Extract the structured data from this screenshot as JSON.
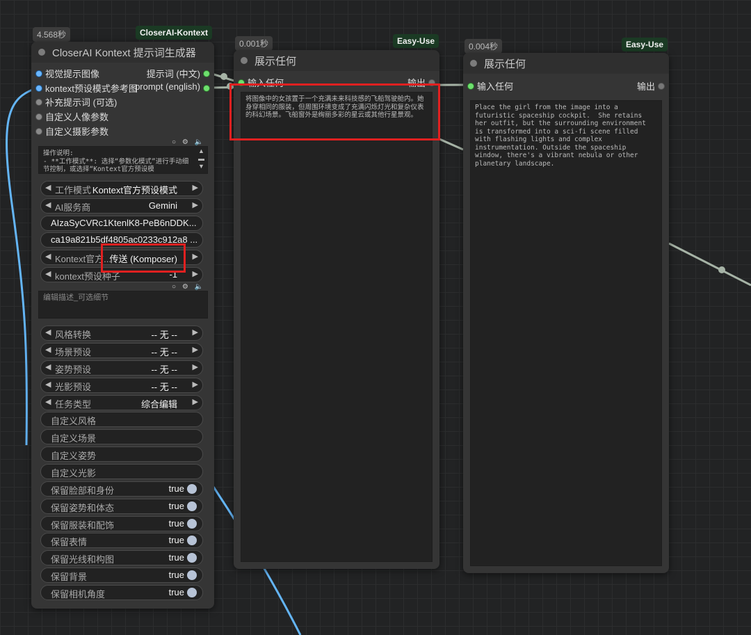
{
  "colors": {
    "canvas_bg": "#222324",
    "node_bg": "#353535",
    "wire_blue": "#64b5f6",
    "wire_gray": "#a6b3a6",
    "highlight": "#e02020",
    "tag_bg": "#1b3a24"
  },
  "node_generator": {
    "time": "4.568秒",
    "tag": "CloserAI-Kontext",
    "title": "CloserAI Kontext 提示词生成器",
    "inputs": [
      {
        "label": "视觉提示图像"
      },
      {
        "label": "kontext预设模式参考图"
      },
      {
        "label": "补充提示词 (可选)"
      },
      {
        "label": "自定义人像参数"
      },
      {
        "label": "自定义摄影参数"
      }
    ],
    "outputs": [
      {
        "label": "提示词 (中文)"
      },
      {
        "label": "prompt (english)"
      }
    ],
    "instructions": "操作说明:\n- **工作模式**: 选择“参数化模式”进行手动细节控制，或选择“Kontext官方预设模\n  式”使用官方提示词",
    "widgets": {
      "work_mode": {
        "label": "工作模式",
        "value": "Kontext官方预设模式"
      },
      "ai_provider": {
        "label": "AI服务商",
        "value": "Gemini"
      },
      "api_key": {
        "value": "AIzaSyCVRc1KtenlK8-PeB6nDDK..."
      },
      "secret": {
        "value": "ca19a821b5df4805ac0233c912a8 ..."
      },
      "kontext_official": {
        "label": "Kontext官方...",
        "value": "传送 (Komposer)"
      },
      "kontext_seed": {
        "label": "kontext预设种子",
        "value": "-1"
      },
      "edit_placeholder": "编辑描述_可选细节",
      "style": {
        "label": "风格转换",
        "value": "-- 无 --"
      },
      "scene": {
        "label": "场景预设",
        "value": "-- 无 --"
      },
      "pose": {
        "label": "姿势预设",
        "value": "-- 无 --"
      },
      "lighting": {
        "label": "光影预设",
        "value": "-- 无 --"
      },
      "task": {
        "label": "任务类型",
        "value": "综合编辑"
      },
      "custom_style": "自定义风格",
      "custom_scene": "自定义场景",
      "custom_pose": "自定义姿势",
      "custom_light": "自定义光影",
      "keep_face": {
        "label": "保留脸部和身份",
        "value": "true"
      },
      "keep_pose": {
        "label": "保留姿势和体态",
        "value": "true"
      },
      "keep_clothes": {
        "label": "保留服装和配饰",
        "value": "true"
      },
      "keep_expression": {
        "label": "保留表情",
        "value": "true"
      },
      "keep_light": {
        "label": "保留光线和构图",
        "value": "true"
      },
      "keep_bg": {
        "label": "保留背景",
        "value": "true"
      },
      "keep_camera": {
        "label": "保留相机角度",
        "value": "true"
      }
    }
  },
  "node_show_cn": {
    "time": "0.001秒",
    "tag": "Easy-Use",
    "title": "展示任何",
    "input_label": "输入任何",
    "output_label": "输出",
    "text": "将图像中的女孩置于一个充满未来科技感的飞船驾驶舱内。她身穿相同的服装，但周围环境变成了充满闪烁灯光和复杂仪表的科幻场景。飞船窗外是绚丽多彩的星云或其他行星景观。"
  },
  "node_show_en": {
    "time": "0.004秒",
    "tag": "Easy-Use",
    "title": "展示任何",
    "input_label": "输入任何",
    "output_label": "输出",
    "text": "Place the girl from the image into a futuristic spaceship cockpit.  She retains her outfit, but the surrounding environment is transformed into a sci-fi scene filled with flashing lights and complex instrumentation. Outside the spaceship window, there's a vibrant nebula or other planetary landscape."
  },
  "icons": {
    "toolbar": "circle-gear-speaker-icons",
    "arrow_left": "◀",
    "arrow_right": "▶"
  }
}
